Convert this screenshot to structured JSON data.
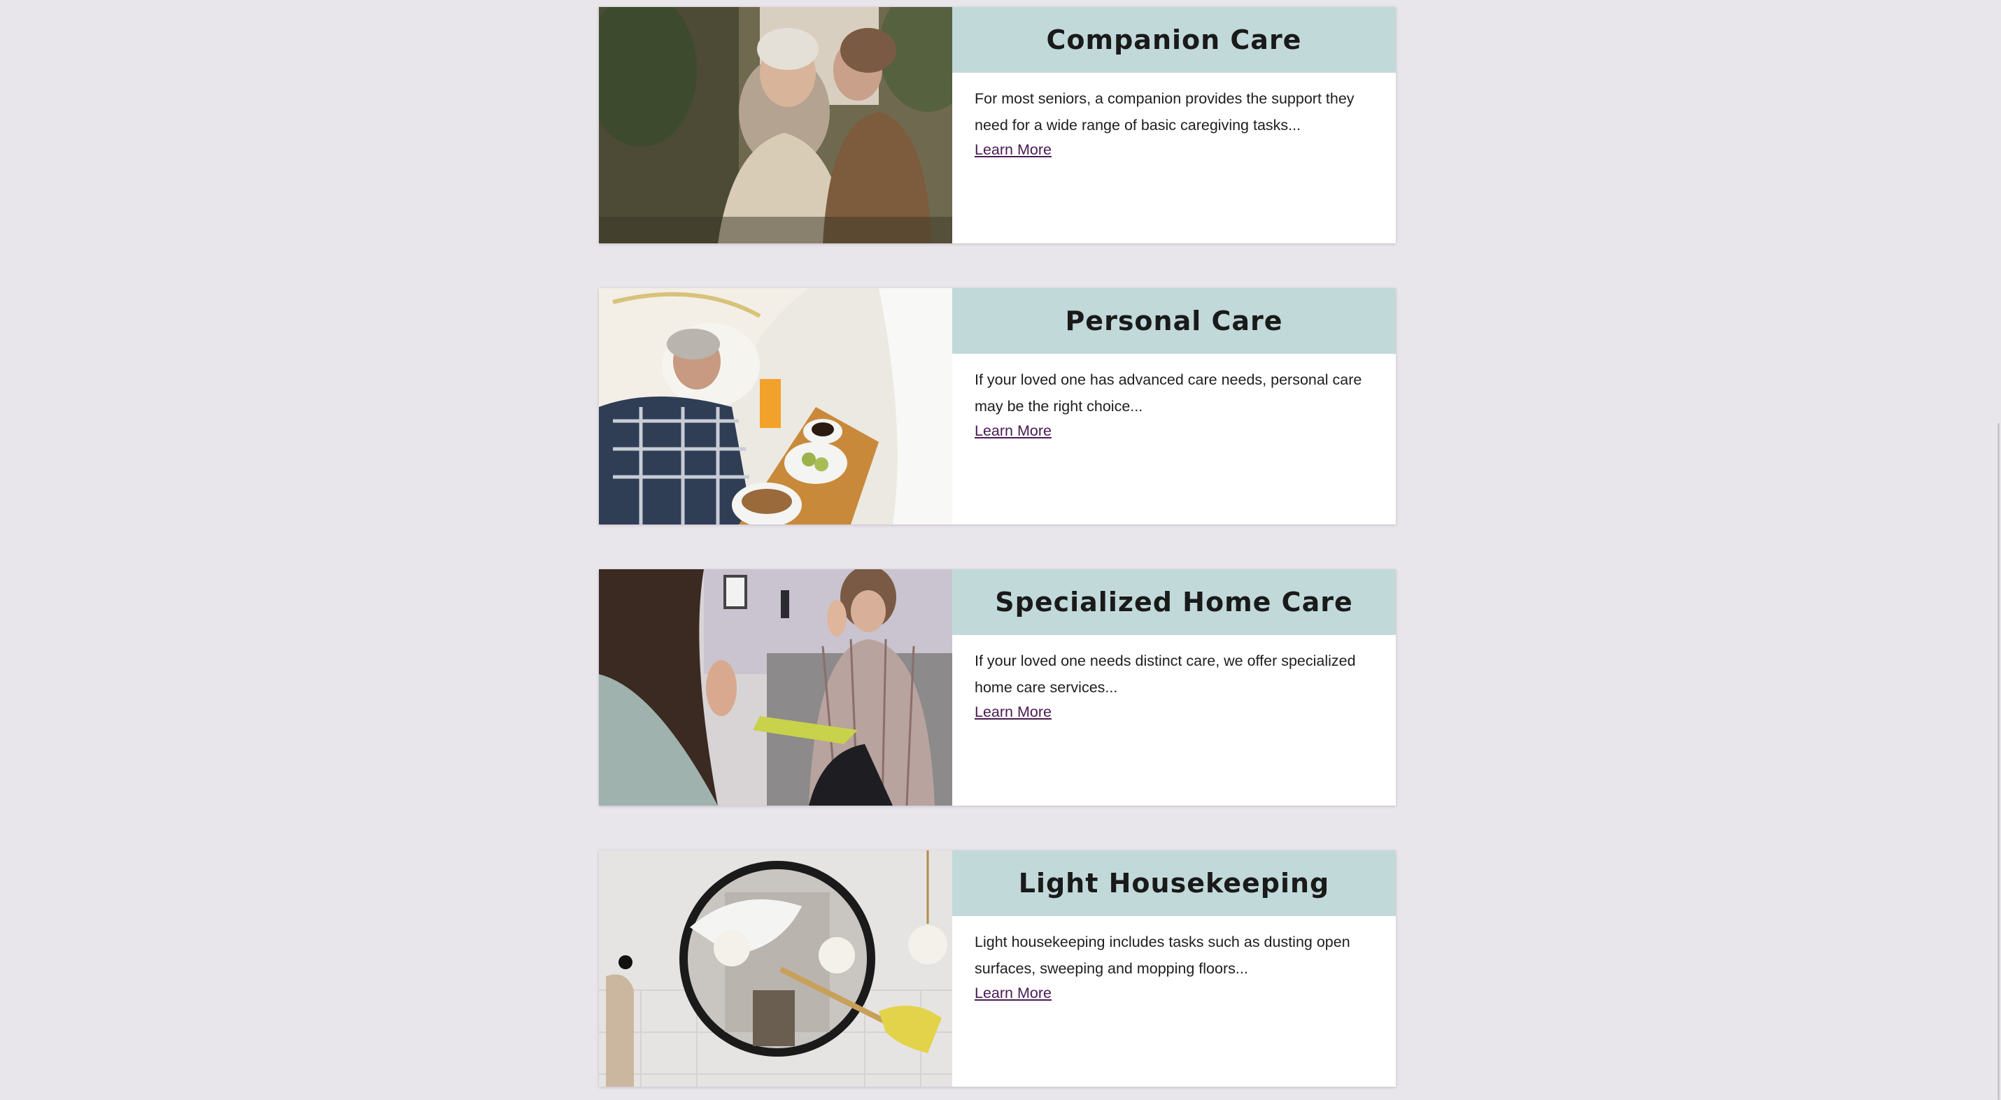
{
  "cards": [
    {
      "title": "Companion Care",
      "description": "For most seniors, a companion provides the support they need for a wide range of basic caregiving tasks...",
      "link": "Learn More",
      "image": "elderly-woman-with-caregiver-photo"
    },
    {
      "title": "Personal Care",
      "description": "If your loved one has advanced care needs, personal care may be the right choice...",
      "link": "Learn More",
      "image": "man-in-bed-with-breakfast-tray-photo"
    },
    {
      "title": "Specialized Home Care",
      "description": "If your loved one needs distinct care, we offer specialized home care services...",
      "link": "Learn More",
      "image": "two-women-talking-on-sofa-photo"
    },
    {
      "title": "Light Housekeeping",
      "description": "Light housekeeping includes tasks such as dusting open surfaces, sweeping and mopping floors...",
      "link": "Learn More",
      "image": "dusting-round-mirror-photo"
    }
  ],
  "colors": {
    "page_background": "#e9e6eb",
    "header_band": "#c2d9da",
    "link": "#4a1a55"
  }
}
